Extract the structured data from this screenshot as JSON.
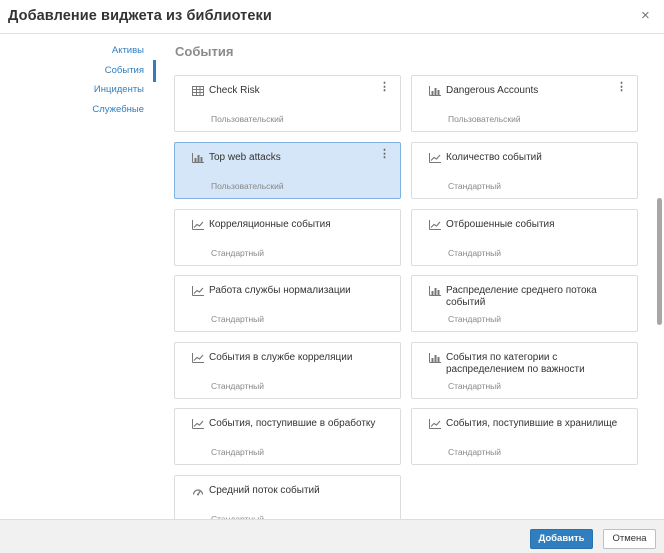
{
  "dialog": {
    "title": "Добавление виджета из библиотеки",
    "close_symbol": "×"
  },
  "nav": {
    "items": [
      {
        "label": "Активы"
      },
      {
        "label": "События",
        "active": true
      },
      {
        "label": "Инциденты"
      },
      {
        "label": "Служебные"
      }
    ]
  },
  "section": {
    "title": "События"
  },
  "cards": [
    {
      "name": "Check Risk",
      "type": "Пользовательский",
      "icon": "table-icon",
      "menu": "⋮"
    },
    {
      "name": "Dangerous Accounts",
      "type": "Пользовательский",
      "icon": "bar-chart-icon",
      "menu": "⋮"
    },
    {
      "name": "Top web attacks",
      "type": "Пользовательский",
      "icon": "bar-chart-icon",
      "menu": "⋮",
      "selected": true
    },
    {
      "name": "Количество событий",
      "type": "Стандартный",
      "icon": "line-chart-icon"
    },
    {
      "name": "Корреляционные события",
      "type": "Стандартный",
      "icon": "line-chart-icon"
    },
    {
      "name": "Отброшенные события",
      "type": "Стандартный",
      "icon": "line-chart-icon"
    },
    {
      "name": "Работа службы нормализации",
      "type": "Стандартный",
      "icon": "line-chart-icon"
    },
    {
      "name": "Распределение среднего потока событий",
      "type": "Стандартный",
      "icon": "bar-chart-icon"
    },
    {
      "name": "События в службе корреляции",
      "type": "Стандартный",
      "icon": "line-chart-icon"
    },
    {
      "name": "События по категории с распределением по важности",
      "type": "Стандартный",
      "icon": "bar-chart-icon"
    },
    {
      "name": "События, поступившие в обработку",
      "type": "Стандартный",
      "icon": "line-chart-icon"
    },
    {
      "name": "События, поступившие в хранилище",
      "type": "Стандартный",
      "icon": "line-chart-icon"
    },
    {
      "name": "Средний поток событий",
      "type": "Стандартный",
      "icon": "gauge-icon"
    }
  ],
  "footer": {
    "add_label": "Добавить",
    "cancel_label": "Отмена"
  },
  "colors": {
    "accent": "#2f7fc0",
    "selected_card": "#d4e6f7",
    "selected_border": "#7fb2e0"
  }
}
